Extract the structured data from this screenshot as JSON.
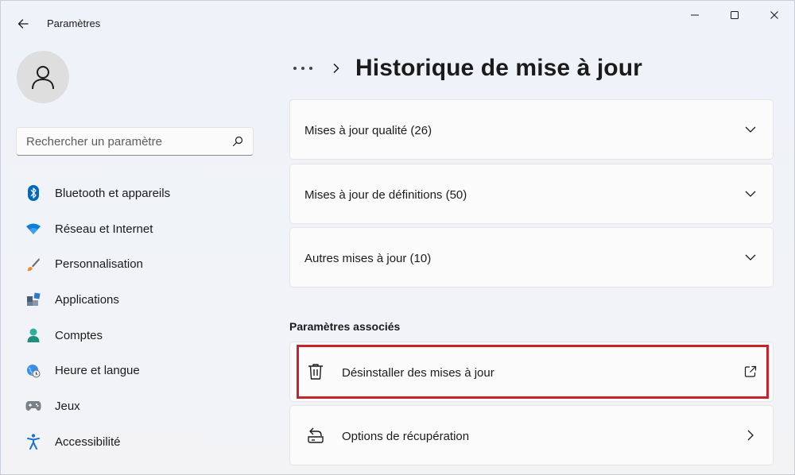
{
  "window": {
    "app_title": "Paramètres",
    "back_icon": "back-arrow-icon",
    "controls": [
      "minimize-icon",
      "maximize-icon",
      "close-icon"
    ]
  },
  "sidebar": {
    "avatar_icon": "user-icon",
    "search": {
      "placeholder": "Rechercher un paramètre",
      "value": "",
      "icon": "search-icon"
    },
    "items": [
      {
        "label": "Bluetooth et appareils",
        "icon": "bluetooth-icon"
      },
      {
        "label": "Réseau et Internet",
        "icon": "wifi-icon"
      },
      {
        "label": "Personnalisation",
        "icon": "brush-icon"
      },
      {
        "label": "Applications",
        "icon": "apps-icon"
      },
      {
        "label": "Comptes",
        "icon": "account-icon"
      },
      {
        "label": "Heure et langue",
        "icon": "globe-clock-icon"
      },
      {
        "label": "Jeux",
        "icon": "gamepad-icon"
      },
      {
        "label": "Accessibilité",
        "icon": "accessibility-icon"
      }
    ]
  },
  "main": {
    "breadcrumb_more_icon": "more-icon",
    "title": "Historique de mise à jour",
    "groups": [
      {
        "label": "Mises à jour qualité (26)",
        "icon": "chevron-down-icon"
      },
      {
        "label": "Mises à jour de définitions (50)",
        "icon": "chevron-down-icon"
      },
      {
        "label": "Autres mises à jour (10)",
        "icon": "chevron-down-icon"
      }
    ],
    "related": {
      "title": "Paramètres associés",
      "items": [
        {
          "label": "Désinstaller des mises à jour",
          "icon": "trash-icon",
          "action_icon": "open-external-icon",
          "highlighted": true
        },
        {
          "label": "Options de récupération",
          "icon": "recovery-icon",
          "action_icon": "chevron-right-icon",
          "highlighted": false
        }
      ]
    }
  },
  "colors": {
    "accent": "#0067c0",
    "highlight_border": "#c8232b",
    "window_bg": "#eef2f9",
    "card_bg": "#fbfbfc"
  }
}
